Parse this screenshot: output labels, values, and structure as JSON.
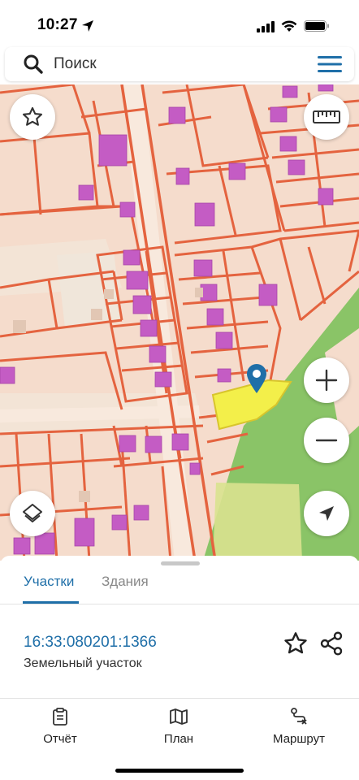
{
  "status_bar": {
    "time": "10:27"
  },
  "search": {
    "placeholder": "Поиск"
  },
  "icons": {
    "search": "search-icon",
    "menu": "menu-icon",
    "favorite": "star-icon",
    "ruler": "ruler-icon",
    "layers": "layers-icon",
    "zoom_in": "plus-icon",
    "zoom_out": "minus-icon",
    "locate": "navigation-arrow-icon",
    "share": "share-icon",
    "report": "clipboard-icon",
    "plan": "map-icon",
    "route": "route-icon"
  },
  "colors": {
    "accent": "#1f6fa8",
    "parcel_border": "#e4633f",
    "building": "#c45cc4",
    "selected_parcel": "#f3ef4a",
    "forest": "#8ac467"
  },
  "tabs": [
    {
      "label": "Участки",
      "active": true
    },
    {
      "label": "Здания",
      "active": false
    }
  ],
  "parcel": {
    "cadastral_number": "16:33:080201:1366",
    "type": "Земельный участок"
  },
  "bottom_nav": [
    {
      "label": "Отчёт"
    },
    {
      "label": "План"
    },
    {
      "label": "Маршрут"
    }
  ]
}
